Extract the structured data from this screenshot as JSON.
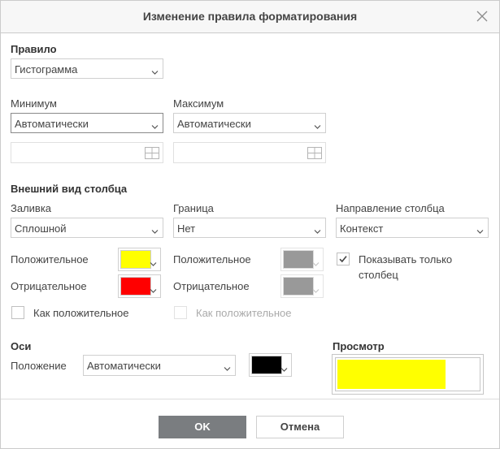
{
  "dialog": {
    "title": "Изменение правила форматирования"
  },
  "rule": {
    "section_label": "Правило",
    "type_value": "Гистограмма"
  },
  "minmax": {
    "min_label": "Минимум",
    "min_value": "Автоматически",
    "max_label": "Максимум",
    "max_value": "Автоматически",
    "min_range_value": "",
    "max_range_value": ""
  },
  "appearance": {
    "section_label": "Внешний вид столбца",
    "fill_label": "Заливка",
    "fill_value": "Сплошной",
    "border_label": "Граница",
    "border_value": "Нет",
    "direction_label": "Направление столбца",
    "direction_value": "Контекст",
    "fill_positive_label": "Положительное",
    "fill_negative_label": "Отрицательное",
    "border_positive_label": "Положительное",
    "border_negative_label": "Отрицательное",
    "fill_same_as_positive_label": "Как положительное",
    "border_same_as_positive_label": "Как положительное",
    "show_bar_only_label_line1": "Показывать только",
    "show_bar_only_label_line2": "столбец",
    "show_bar_only_checked": true
  },
  "colors": {
    "fill_positive": "#ffff00",
    "fill_negative": "#ff0000",
    "border_positive": "#999999",
    "border_negative": "#999999",
    "axis": "#000000",
    "preview_bar": "#ffff00",
    "ok_button": "#7a7d80"
  },
  "axis": {
    "section_label": "Оси",
    "position_label": "Положение",
    "position_value": "Автоматически"
  },
  "preview": {
    "section_label": "Просмотр",
    "bar_fraction": 0.77
  },
  "footer": {
    "ok_label": "OK",
    "cancel_label": "Отмена"
  },
  "icons": {
    "close": "close-icon",
    "dropdown": "chevron-down-icon",
    "range_select": "range-grid-icon",
    "checkmark": "checkmark-icon"
  }
}
